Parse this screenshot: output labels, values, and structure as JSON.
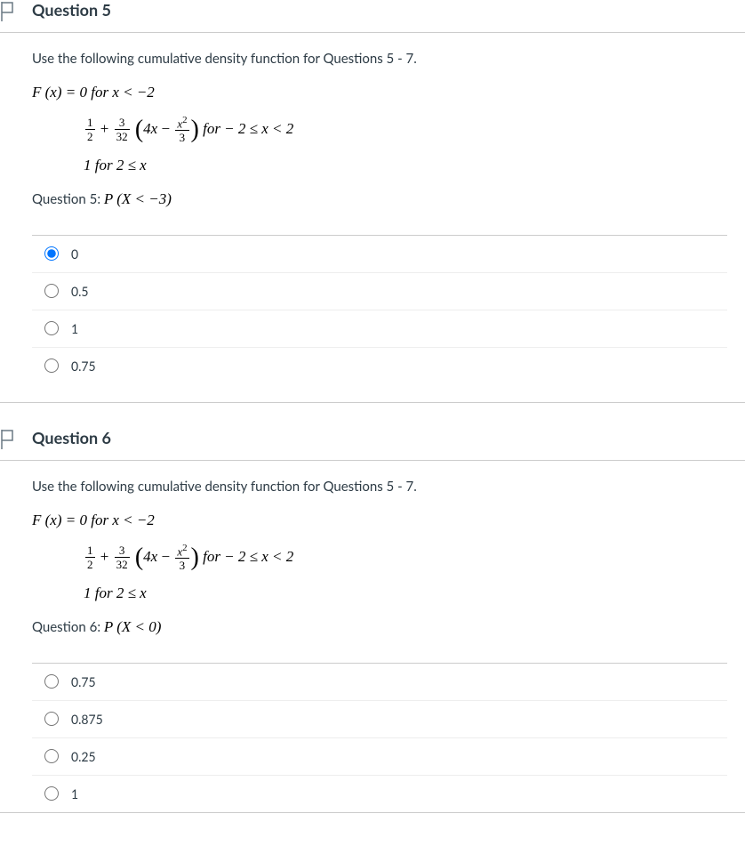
{
  "q5": {
    "title": "Question 5",
    "intro": "Use the following cumulative density function for Questions 5 - 7.",
    "line1_a": "F (x) = 0 for x < −2",
    "line2_for": " for − 2 ≤ x < 2",
    "line3": "1 for 2 ≤ x",
    "prompt_label": "Question 5: ",
    "prompt_math": "P (X < −3)",
    "options": {
      "a": "0",
      "b": "0.5",
      "c": "1",
      "d": "0.75"
    }
  },
  "q6": {
    "title": "Question 6",
    "intro": "Use the following cumulative density function for Questions 5 - 7.",
    "line1_a": "F (x) = 0 for x < −2",
    "line2_for": " for − 2 ≤ x < 2",
    "line3": "1 for 2 ≤ x",
    "prompt_label": "Question 6: ",
    "prompt_math": "P (X < 0)",
    "options": {
      "a": "0.75",
      "b": "0.875",
      "c": "0.25",
      "d": "1"
    }
  },
  "math": {
    "half_num": "1",
    "half_den": "2",
    "c2_num": "3",
    "c2_den": "32",
    "term_4x": "4x",
    "x2_num": "x",
    "x2_sup": "2",
    "x2_den": "3"
  }
}
